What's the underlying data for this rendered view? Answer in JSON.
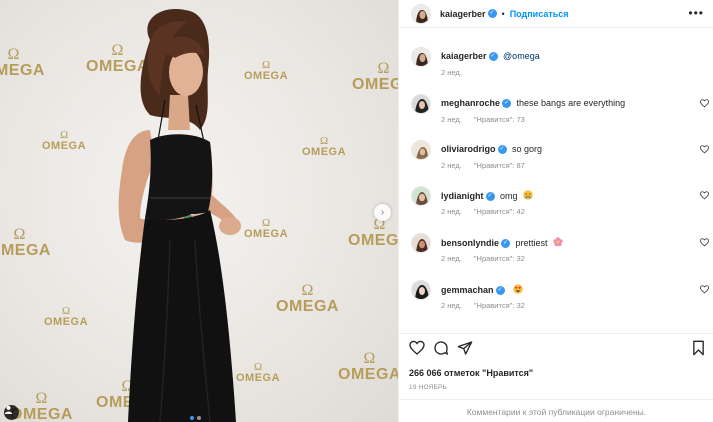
{
  "post": {
    "author": "kaiagerber",
    "follow_label": "Подписаться",
    "separator": "•",
    "more_label": "•••"
  },
  "photo": {
    "watermark_text": "OMEGA",
    "watermark_symbol": "Ω",
    "next_label": "›",
    "carousel": {
      "count": 2,
      "active": 1
    }
  },
  "caption": {
    "username": "kaiagerber",
    "text": "@omega",
    "time": "2 нед."
  },
  "comments": [
    {
      "username": "meghanroche",
      "text": "these bangs are everything",
      "time": "2 нед.",
      "likes": "\"Нравится\": 73",
      "emoji": ""
    },
    {
      "username": "oliviarodrigo",
      "text": "so gorg",
      "time": "2 нед.",
      "likes": "\"Нравится\": 87",
      "emoji": ""
    },
    {
      "username": "lydianight",
      "text": "omg",
      "time": "2 нед.",
      "likes": "\"Нравится\": 42",
      "emoji": "crying-face"
    },
    {
      "username": "bensonlyndie",
      "text": "prettiest",
      "time": "2 нед.",
      "likes": "\"Нравится\": 32",
      "emoji": "flower"
    },
    {
      "username": "gemmachan",
      "text": "",
      "time": "2 нед.",
      "likes": "\"Нравится\": 32",
      "emoji": "heart-eyes"
    }
  ],
  "footer": {
    "likes_count": "266 066 отметок \"Нравится\"",
    "date": "19 НОЯБРЬ",
    "comments_restricted": "Комментарии к этой публикации ограничены."
  },
  "colors": {
    "accent": "#0095f6",
    "verified": "#3897f0",
    "muted": "#8e8e8e",
    "watermark": "#b79d5c"
  }
}
